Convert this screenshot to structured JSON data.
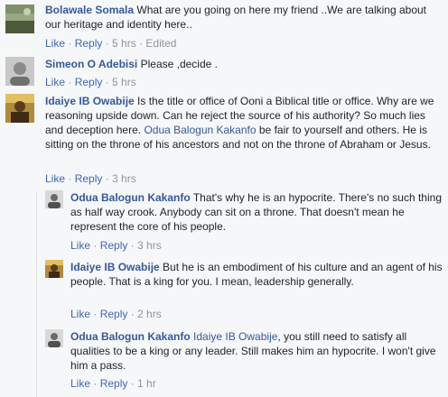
{
  "actions": {
    "like": "Like",
    "reply": "Reply",
    "dot": " · "
  },
  "comments": [
    {
      "author": "Bolawale Somala",
      "text": "What are you going on here my friend ..We are talking about our heritage and identity here..",
      "time": "5 hrs",
      "edited": "Edited"
    },
    {
      "author": "Simeon O Adebisi",
      "text": "Please ,decide .",
      "time": "5 hrs"
    },
    {
      "author": "Idaiye IB Owabije",
      "text1": "Is the title or office of Ooni a Biblical title or office. Why are we reasoning upside down. Can he reject the source of his authority? So much lies and deception here.",
      "mention": "Odua Balogun Kakanfo",
      "text2": "be fair to yourself and others. He is sitting on the throne of his ancestors and not on the throne of Abraham or Jesus.",
      "time": "3 hrs"
    }
  ],
  "replies": [
    {
      "author": "Odua Balogun Kakanfo",
      "text": "That's why he is an hypocrite. There's no such thing as half way crook. Anybody can sit on a throne. That doesn't mean he represent the core of his people.",
      "time": "3 hrs"
    },
    {
      "author": "Idaiye IB Owabije",
      "text": "But he is an embodiment of his culture and an agent of his people. That is a king for you. I mean, leadership generally.",
      "time": "2 hrs"
    },
    {
      "author": "Odua Balogun Kakanfo",
      "mention": "Idaiye IB Owabije",
      "text": ", you still need to satisfy all qualities to be a king or any leader. Still makes him an hypocrite. I won't give him a pass.",
      "time": "1 hr"
    }
  ]
}
